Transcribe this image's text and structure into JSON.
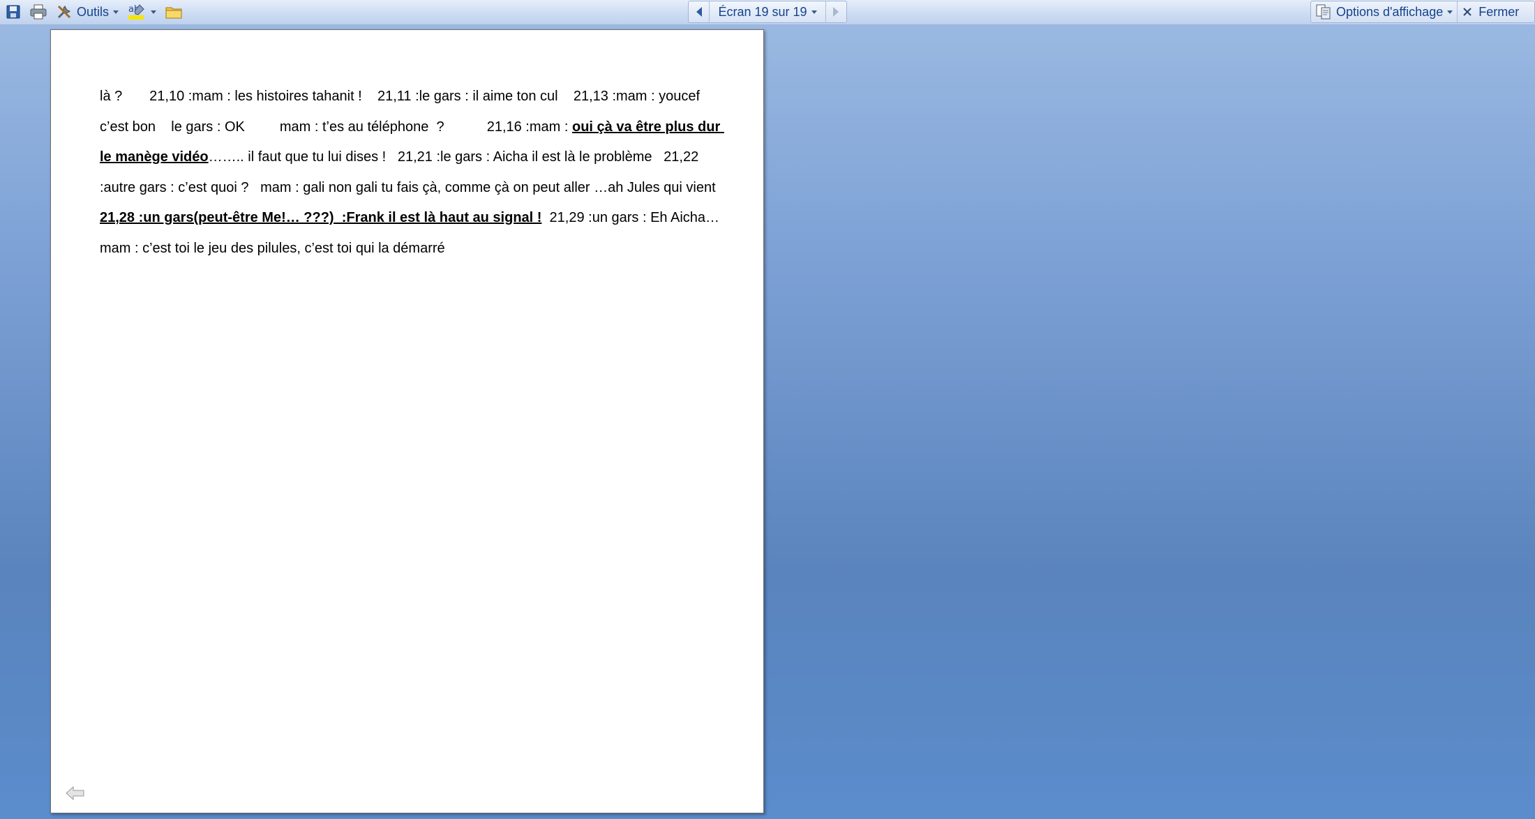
{
  "toolbar": {
    "tools_label": "Outils",
    "nav_label": "Écran 19 sur 19",
    "options_label": "Options d'affichage",
    "close_label": "Fermer"
  },
  "document": {
    "segments": [
      {
        "text": "là ?       21,10 :mam : les histoires tahanit !    21,11 :le gars : il aime ton cul    21,13 :mam : youcef c’est bon    le gars : OK         mam : t’es au téléphone  ?           21,16 :mam : ",
        "style": "normal"
      },
      {
        "text": "oui çà va être plus dur le manège vidéo",
        "style": "bold-underline"
      },
      {
        "text": "…….. il faut que tu lui dises !   21,21 :le gars : Aicha il est là le problème   21,22 :autre gars : c’est quoi ?   mam : gali non gali tu fais çà, comme çà on peut aller …ah Jules qui vient        ",
        "style": "normal"
      },
      {
        "text": "21,28 :un gars(peut-être Me!… ???)  :Frank il est là haut au signal !",
        "style": "bold-underline"
      },
      {
        "text": "  21,29 :un gars : Eh Aicha…   mam : c’est toi le jeu des pilules, c’est toi qui la démarré",
        "style": "normal"
      }
    ]
  },
  "colors": {
    "toolbar_text": "#15428b",
    "background_top": "#9dbbe3",
    "background_bottom": "#5b8ccc",
    "page": "#ffffff"
  }
}
